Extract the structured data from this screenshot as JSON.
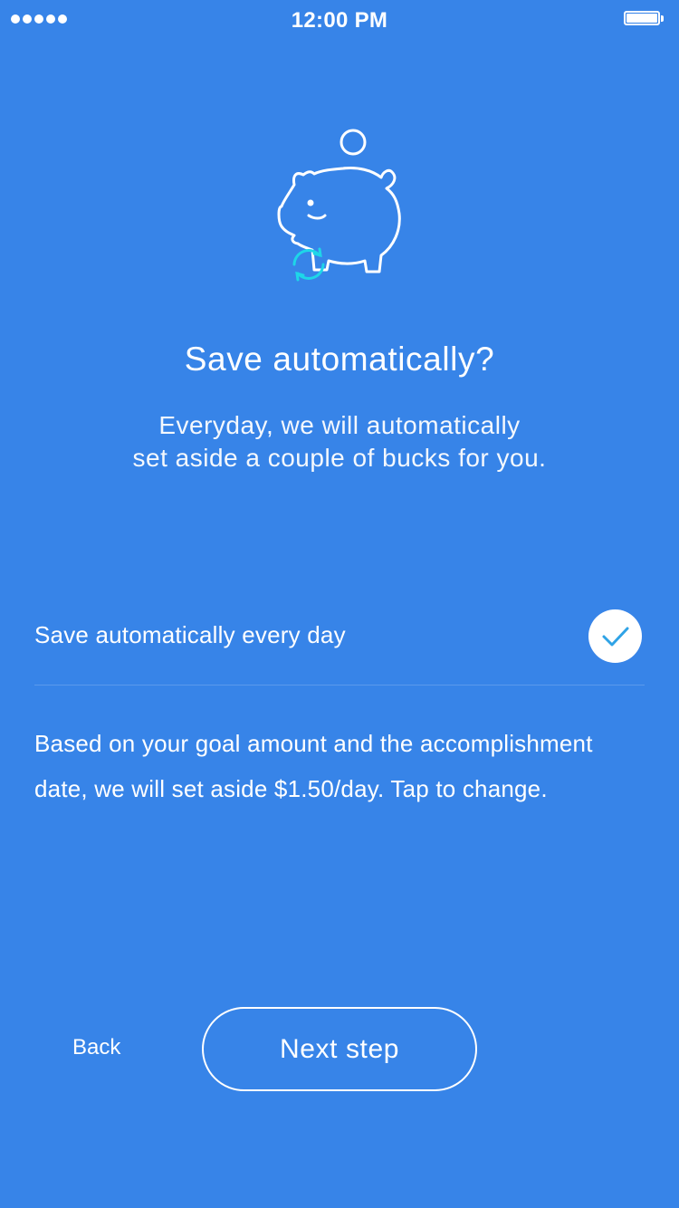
{
  "status_bar": {
    "time": "12:00 PM",
    "signal_icon": "signal-dots-icon",
    "battery_icon": "battery-icon",
    "battery_level": 1.0
  },
  "hero": {
    "icon": "piggy-bank-icon",
    "badge_icon": "sync-icon",
    "coin_icon": "coin-icon",
    "badge_color": "#1ED6E8"
  },
  "title": "Save automatically?",
  "subtitle_lines": [
    "Everyday, we will automatically",
    "set aside a couple of bucks for you."
  ],
  "auto_save": {
    "label": "Save automatically every day",
    "checked": true,
    "check_icon": "checkmark-icon",
    "check_color": "#2FA3E6"
  },
  "info_text": "Based on your goal amount and the accomplishment date, we will set aside $1.50/day. Tap to change.",
  "footer": {
    "back_label": "Back",
    "next_label": "Next step"
  },
  "colors": {
    "background": "#3784E8",
    "foreground": "#FFFFFF"
  }
}
